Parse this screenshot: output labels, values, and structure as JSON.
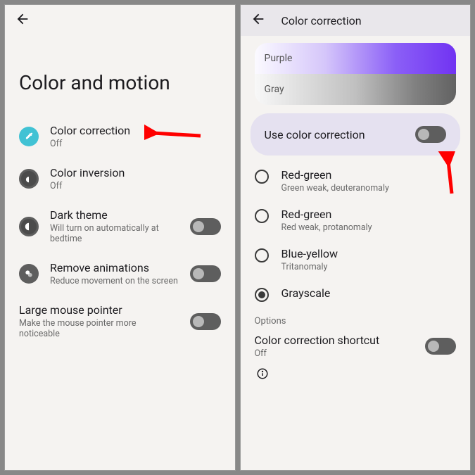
{
  "left": {
    "title": "Color and motion",
    "items": [
      {
        "label": "Color correction",
        "sub": "Off"
      },
      {
        "label": "Color inversion",
        "sub": "Off"
      },
      {
        "label": "Dark theme",
        "sub": "Will turn on automatically at bedtime"
      },
      {
        "label": "Remove animations",
        "sub": "Reduce movement on the screen"
      },
      {
        "label": "Large mouse pointer",
        "sub": "Make the mouse pointer more noticeable"
      }
    ]
  },
  "right": {
    "header_title": "Color correction",
    "preview": {
      "purple": "Purple",
      "gray": "Gray"
    },
    "card_label": "Use color correction",
    "options": [
      {
        "label": "Red-green",
        "sub": "Green weak, deuteranomaly"
      },
      {
        "label": "Red-green",
        "sub": "Red weak, protanomaly"
      },
      {
        "label": "Blue-yellow",
        "sub": "Tritanomaly"
      },
      {
        "label": "Grayscale",
        "sub": ""
      }
    ],
    "section_label": "Options",
    "shortcut": {
      "label": "Color correction shortcut",
      "sub": "Off"
    }
  }
}
